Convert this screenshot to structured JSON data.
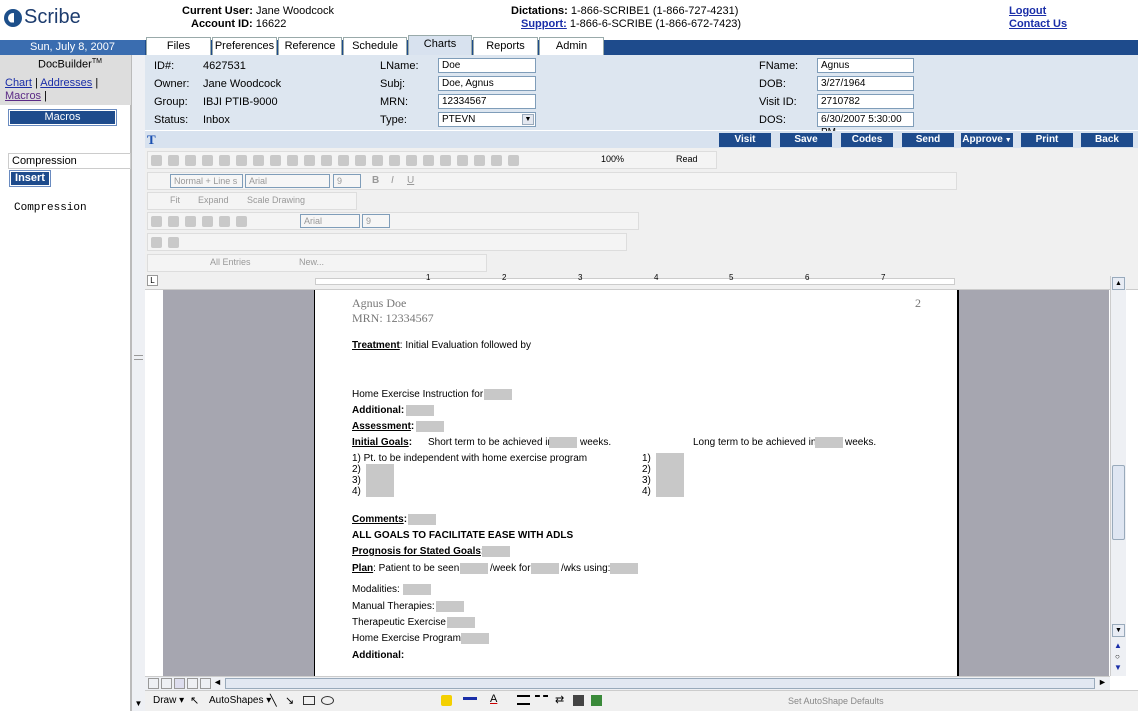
{
  "header": {
    "logo": "Scribe",
    "current_user_label": "Current User:",
    "current_user": "Jane Woodcock",
    "account_label": "Account ID:",
    "account_id": "16622",
    "dictations_label": "Dictations:",
    "dictations_phone": "1-866-SCRIBE1 (1-866-727-4231)",
    "support_label": "Support:",
    "support_phone": "1-866-6-SCRIBE (1-866-672-7423)",
    "logout": "Logout",
    "contact": "Contact Us"
  },
  "date": "Sun, July 8, 2007",
  "tabs": [
    "Files",
    "Preferences",
    "Reference",
    "Schedule",
    "Charts",
    "Reports",
    "Admin"
  ],
  "left": {
    "title": "DocBuilder",
    "title_sup": "TM",
    "links": [
      "Chart",
      "Addresses",
      "Macros"
    ],
    "macros_button": "Macros",
    "macro_item": "Compression",
    "insert_button": "Insert",
    "preview_text": "Compression"
  },
  "patient": {
    "id_label": "ID#:",
    "id": "4627531",
    "owner_label": "Owner:",
    "owner": "Jane Woodcock",
    "group_label": "Group:",
    "group": "IBJI PTIB-9000",
    "status_label": "Status:",
    "status": "Inbox",
    "lname_label": "LName:",
    "lname": "Doe",
    "subj_label": "Subj:",
    "subj": "Doe, Agnus",
    "mrn_label": "MRN:",
    "mrn": "12334567",
    "type_label": "Type:",
    "type": "PTEVN",
    "fname_label": "FName:",
    "fname": "Agnus",
    "dob_label": "DOB:",
    "dob": "3/27/1964",
    "visit_label": "Visit ID:",
    "visit_id": "2710782",
    "dos_label": "DOS:",
    "dos": "6/30/2007 5:30:00 PM"
  },
  "actions": [
    "Visit",
    "Save",
    "Codes",
    "Send",
    "Approve",
    "Print",
    "Back"
  ],
  "toolbar": {
    "zoom": "100%",
    "read": "Read",
    "style": "Normal + Line s",
    "font": "Arial",
    "size": "9",
    "fit": "Fit",
    "expand": "Expand",
    "scale": "Scale Drawing",
    "all_entries": "All Entries",
    "new": "New..."
  },
  "ruler_numbers": [
    "1",
    "2",
    "3",
    "4",
    "5",
    "6",
    "7"
  ],
  "document": {
    "patient_name": "Agnus Doe",
    "page_number": "2",
    "mrn_line": "MRN: 12334567",
    "treatment_label": "Treatment",
    "treatment_text": ":  Initial Evaluation followed by",
    "hep_instruction": "Home Exercise Instruction for:",
    "additional_label": "Additional:",
    "assessment_label": "Assessment",
    "assessment_colon": ":",
    "initial_goals_label": "Initial Goals",
    "initial_goals_colon": ":",
    "short_term_text": "Short term to be achieved in",
    "weeks": "weeks.",
    "long_term_text": "Long term to be achieved in",
    "goal1": "1)  Pt. to be independent with home exercise program",
    "goal_nums": [
      "2)",
      "3)",
      "4)"
    ],
    "lt_nums": [
      "1)",
      "2)",
      "3)",
      "4)"
    ],
    "comments_label": "Comments",
    "comments_colon": ":",
    "all_goals": "ALL GOALS TO FACILITATE EASE WITH ADLS",
    "prognosis_label": "Prognosis for Stated Goals",
    "prognosis_colon": ":",
    "plan_label": "Plan",
    "plan_text": ":  Patient to be seen",
    "per_week": "/week for",
    "wks_using": "/wks using:",
    "modalities": "Modalities:",
    "manual": "Manual Therapies:",
    "therapeutic": "Therapeutic Exercise",
    "hep_program": "Home Exercise Program",
    "additional2": "Additional:"
  },
  "drawbar": {
    "draw": "Draw",
    "autoshapes": "AutoShapes",
    "set_defaults": "Set AutoShape Defaults"
  }
}
